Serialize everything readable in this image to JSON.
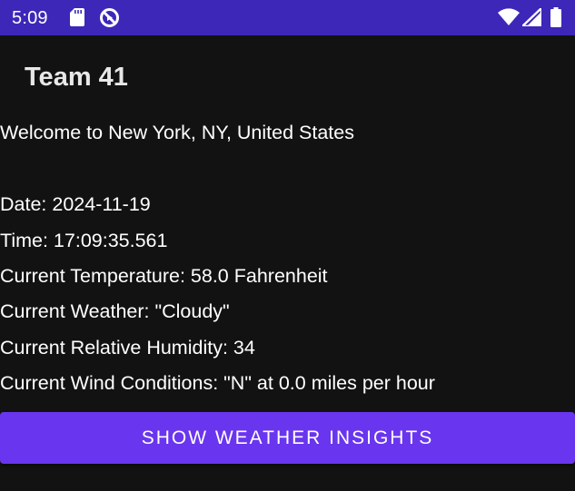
{
  "status_bar": {
    "time": "5:09",
    "icons": [
      "sd-card-icon",
      "sync-off-icon",
      "wifi-icon",
      "signal-icon",
      "battery-icon"
    ]
  },
  "app_bar": {
    "title": "Team 41"
  },
  "content": {
    "welcome": "Welcome to New York, NY, United States",
    "date": "Date: 2024-11-19",
    "time": "Time: 17:09:35.561",
    "temperature": "Current Temperature: 58.0 Fahrenheit",
    "weather": "Current Weather: \"Cloudy\"",
    "humidity": "Current Relative Humidity: 34",
    "wind": "Current Wind Conditions: \"N\" at 0.0 miles per hour"
  },
  "actions": {
    "insights_button": "Show Weather Insights"
  },
  "colors": {
    "status_bar": "#3c27b9",
    "background": "#121212",
    "button": "#6a35ef",
    "text": "#ffffff"
  }
}
